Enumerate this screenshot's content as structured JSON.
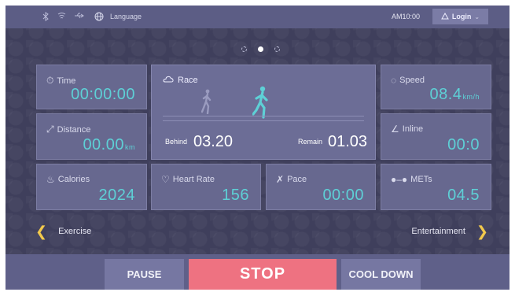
{
  "topbar": {
    "icons": [
      "bluetooth-icon",
      "wifi-icon",
      "usb-icon",
      "globe-icon"
    ],
    "language_label": "Language",
    "clock": "AM10:00",
    "login_label": "Login"
  },
  "pager": {
    "count": 3,
    "active_index": 1
  },
  "tiles": {
    "time": {
      "label": "Time",
      "value": "00:00:00"
    },
    "distance": {
      "label": "Distance",
      "value": "00.00",
      "unit": "km"
    },
    "calories": {
      "label": "Calories",
      "value": "2024"
    },
    "race": {
      "label": "Race",
      "behind_label": "Behind",
      "behind_value": "03.20",
      "remain_label": "Remain",
      "remain_value": "01.03"
    },
    "heart_rate": {
      "label": "Heart Rate",
      "value": "156"
    },
    "pace": {
      "label": "Pace",
      "value": "00:00"
    },
    "speed": {
      "label": "Speed",
      "value": "08.4",
      "unit": "km/h"
    },
    "incline": {
      "label": "Inline",
      "value": "00:0"
    },
    "mets": {
      "label": "METs",
      "value": "04.5"
    }
  },
  "nav": {
    "left_label": "Exercise",
    "right_label": "Entertainment"
  },
  "controls": {
    "pause_label": "PAUSE",
    "stop_label": "STOP",
    "cool_down_label": "COOL DOWN"
  },
  "colors": {
    "accent_value": "#5ed0d6",
    "stop": "#ee7281",
    "arrow": "#f2c94c",
    "background": "#3f3f5c"
  }
}
